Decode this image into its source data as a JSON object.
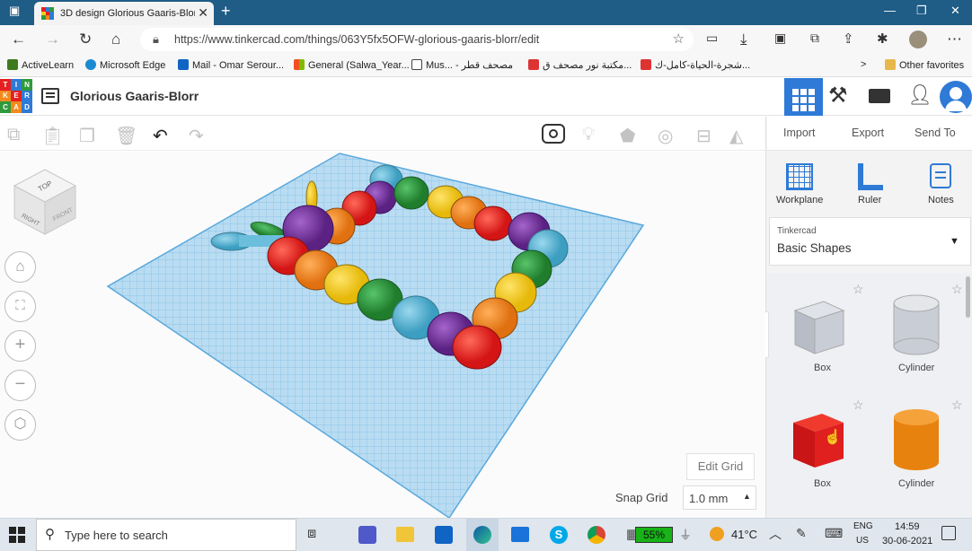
{
  "browser": {
    "tab_title": "3D design Glorious Gaaris-Blorr |",
    "tab_close": "✕",
    "new_tab": "+",
    "url": "https://www.tinkercad.com/things/063Y5fx5OFW-glorious-gaaris-blorr/edit",
    "bookmarks": [
      "ActiveLearn",
      "Microsoft Edge",
      "Mail - Omar Serour...",
      "General (Salwa_Year...",
      "Mus... - مصحف قطر",
      "مكتبة نور مصحف ق...",
      "شجرة-الحياة-كامل-ك..."
    ],
    "other_favorites": "Other favorites",
    "more": ">"
  },
  "app": {
    "logo_letters": [
      "T",
      "I",
      "N",
      "K",
      "E",
      "R",
      "C",
      "A",
      "D"
    ],
    "design_title": "Glorious Gaaris-Blorr"
  },
  "actions": {
    "import": "Import",
    "export": "Export",
    "send_to": "Send To"
  },
  "panel_tools": [
    "Workplane",
    "Ruler",
    "Notes"
  ],
  "library": {
    "source": "Tinkercad",
    "category": "Basic Shapes"
  },
  "shapes": [
    {
      "label": "Box",
      "color": "#c8ccd6",
      "kind": "box"
    },
    {
      "label": "Cylinder",
      "color": "#c8ccd6",
      "kind": "cyl"
    },
    {
      "label": "Box",
      "color": "#e62020",
      "kind": "box"
    },
    {
      "label": "Cylinder",
      "color": "#e8820e",
      "kind": "cyl"
    }
  ],
  "workplane": {
    "edit_grid": "Edit Grid",
    "snap_grid_label": "Snap Grid",
    "snap_grid_value": "1.0 mm",
    "viewcube": {
      "top": "TOP",
      "right": "RIGHT",
      "front": "FRONT"
    }
  },
  "taskbar": {
    "search_placeholder": "Type here to search",
    "battery": "55%",
    "temperature": "41°C",
    "language": "ENG",
    "region": "US",
    "time": "14:59",
    "date": "30-06-2021"
  },
  "colors": {
    "tinkercad_blue": "#2e7ad6",
    "red": "#e62020",
    "orange": "#f28a1e",
    "yellow": "#f3cd1a",
    "green": "#2f9a3c",
    "teal": "#5eb8d6",
    "purple": "#7a3aa2"
  }
}
